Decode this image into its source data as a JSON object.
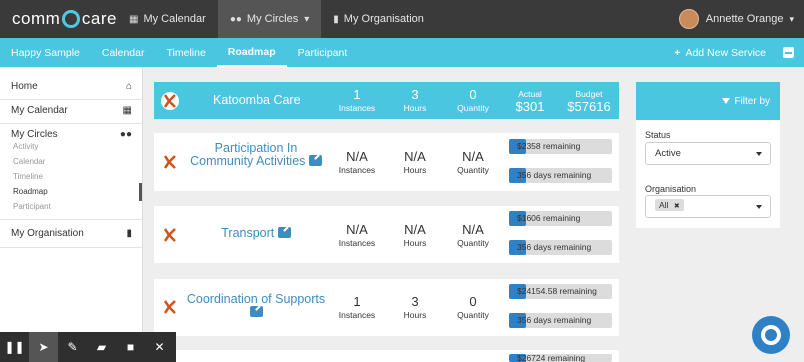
{
  "topbar": {
    "logo_left": "comm",
    "logo_right": "care",
    "nav": [
      {
        "label": "My Calendar",
        "icon": "calendar-icon"
      },
      {
        "label": "My Circles",
        "icon": "people-icon"
      },
      {
        "label": "My Organisation",
        "icon": "building-icon"
      }
    ],
    "user_name": "Annette Orange"
  },
  "subnav": {
    "items": [
      "Happy Sample",
      "Calendar",
      "Timeline",
      "Roadmap",
      "Participant"
    ],
    "active": "Roadmap",
    "add_service": "Add New Service"
  },
  "sidebar": {
    "home": "Home",
    "my_calendar": "My Calendar",
    "my_circles": "My Circles",
    "circle_subitems": [
      "Activity",
      "Calendar",
      "Timeline",
      "Roadmap",
      "Participant"
    ],
    "my_organisation": "My Organisation"
  },
  "summary": {
    "name": "Katoomba Care",
    "instances_value": "1",
    "instances_label": "Instances",
    "hours_value": "3",
    "hours_label": "Hours",
    "quantity_value": "0",
    "quantity_label": "Quantity",
    "actual_label": "Actual",
    "actual_value": "$301",
    "budget_label": "Budget",
    "budget_value": "$57616"
  },
  "services": [
    {
      "title": "Participation In Community Activities",
      "instances": "N/A",
      "instances_label": "Instances",
      "hours": "N/A",
      "hours_label": "Hours",
      "quantity": "N/A",
      "quantity_label": "Quantity",
      "budget_remaining": "$2358 remaining",
      "days_remaining": "356 days remaining"
    },
    {
      "title": "Transport",
      "instances": "N/A",
      "instances_label": "Instances",
      "hours": "N/A",
      "hours_label": "Hours",
      "quantity": "N/A",
      "quantity_label": "Quantity",
      "budget_remaining": "$1606 remaining",
      "days_remaining": "356 days remaining"
    },
    {
      "title": "Coordination of Supports",
      "instances": "1",
      "instances_label": "Instances",
      "hours": "3",
      "hours_label": "Hours",
      "quantity": "0",
      "quantity_label": "Quantity",
      "budget_remaining": "$24154.58 remaining",
      "days_remaining": "356 days remaining"
    },
    {
      "budget_remaining": "$26724 remaining"
    }
  ],
  "filter": {
    "title": "Filter by",
    "status_label": "Status",
    "status_value": "Active",
    "organisation_label": "Organisation",
    "organisation_tag": "All",
    "tag_remove": "✖"
  },
  "toolbar": {
    "icons": [
      "pause-icon",
      "pointer-icon",
      "pen-icon",
      "eraser-icon",
      "camera-icon",
      "close-icon"
    ]
  },
  "colors": {
    "accent": "#4ac6e0",
    "topbar": "#3a3a3a",
    "link": "#3e8dc1",
    "bar_fill": "#2f81c6"
  }
}
